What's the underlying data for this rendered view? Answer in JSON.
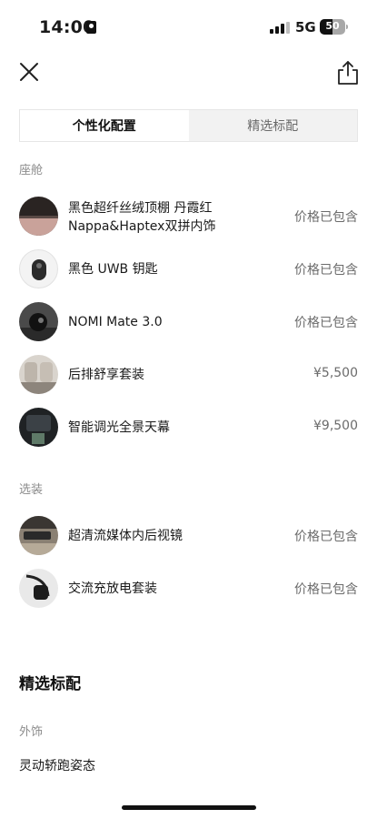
{
  "status_bar": {
    "time": "14:00",
    "network": "5G",
    "battery": "50",
    "battery_level": 0.5
  },
  "tabs": [
    {
      "label": "个性化配置",
      "active": true
    },
    {
      "label": "精选标配",
      "active": false
    }
  ],
  "sections": {
    "cabin": {
      "label": "座舱",
      "items": [
        {
          "title_line1": "黑色超纤丝绒顶棚 丹霞红",
          "title_line2": "Nappa&Haptex双拼内饰",
          "price": "价格已包含",
          "icon": "interior-swatch-thumb"
        },
        {
          "title_line1": "黑色 UWB 钥匙",
          "price": "价格已包含",
          "icon": "uwb-key-thumb"
        },
        {
          "title_line1": "NOMI Mate 3.0",
          "price": "价格已包含",
          "icon": "nomi-mate-thumb"
        },
        {
          "title_line1": "后排舒享套装",
          "price": "¥5,500",
          "icon": "rear-seat-thumb"
        },
        {
          "title_line1": "智能调光全景天幕",
          "price": "¥9,500",
          "icon": "panoramic-roof-thumb"
        }
      ]
    },
    "options": {
      "label": "选装",
      "items": [
        {
          "title_line1": "超清流媒体内后视镜",
          "price": "价格已包含",
          "icon": "mirror-thumb"
        },
        {
          "title_line1": "交流充放电套装",
          "price": "价格已包含",
          "icon": "charger-thumb"
        }
      ]
    }
  },
  "featured": {
    "heading": "精选标配",
    "exterior_label": "外饰",
    "first_item": "灵动轿跑姿态"
  },
  "colors": {
    "tab_inactive_bg": "#f2f2f2",
    "muted_text": "#8c8c8c"
  }
}
